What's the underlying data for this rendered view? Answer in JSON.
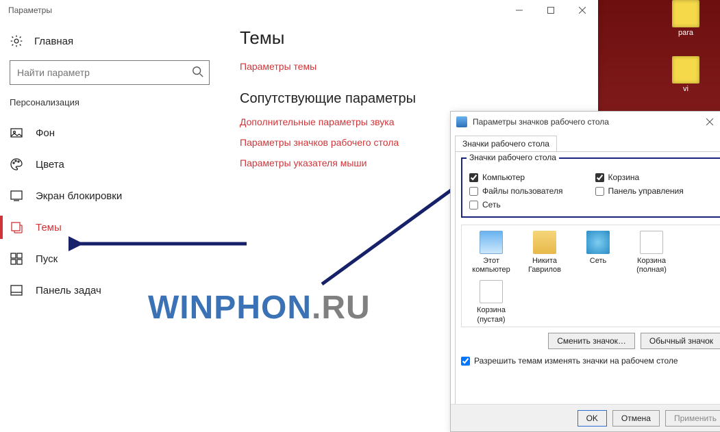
{
  "desktop": {
    "icons": [
      {
        "label": "para"
      },
      {
        "label": "vi"
      }
    ]
  },
  "settings": {
    "title": "Параметры",
    "home": "Главная",
    "search_placeholder": "Найти параметр",
    "section": "Персонализация",
    "nav": [
      {
        "label": "Фон"
      },
      {
        "label": "Цвета"
      },
      {
        "label": "Экран блокировки"
      },
      {
        "label": "Темы"
      },
      {
        "label": "Пуск"
      },
      {
        "label": "Панель задач"
      }
    ],
    "main": {
      "heading1": "Темы",
      "link1": "Параметры темы",
      "heading2": "Сопутствующие параметры",
      "links": [
        "Дополнительные параметры звука",
        "Параметры значков рабочего стола",
        "Параметры указателя мыши"
      ]
    }
  },
  "dialog": {
    "title": "Параметры значков рабочего стола",
    "tab": "Значки рабочего стола",
    "group_label": "Значки рабочего стола",
    "checkboxes": {
      "computer": {
        "label": "Компьютер",
        "checked": true
      },
      "recycle": {
        "label": "Корзина",
        "checked": true
      },
      "userfiles": {
        "label": "Файлы пользователя",
        "checked": false
      },
      "control_panel": {
        "label": "Панель управления",
        "checked": false
      },
      "network": {
        "label": "Сеть",
        "checked": false
      }
    },
    "icons": [
      {
        "label": "Этот компьютер",
        "kind": "monitor"
      },
      {
        "label": "Никита Гаврилов",
        "kind": "user"
      },
      {
        "label": "Сеть",
        "kind": "net"
      },
      {
        "label": "Корзина (полная)",
        "kind": "bin"
      },
      {
        "label": "Корзина (пустая)",
        "kind": "bin"
      }
    ],
    "change_icon": "Сменить значок…",
    "default_icon": "Обычный значок",
    "allow_themes": "Разрешить темам изменять значки на рабочем столе",
    "ok": "OK",
    "cancel": "Отмена",
    "apply": "Применить"
  },
  "watermark": {
    "part1": "WINPHON",
    "part2": ".RU"
  }
}
